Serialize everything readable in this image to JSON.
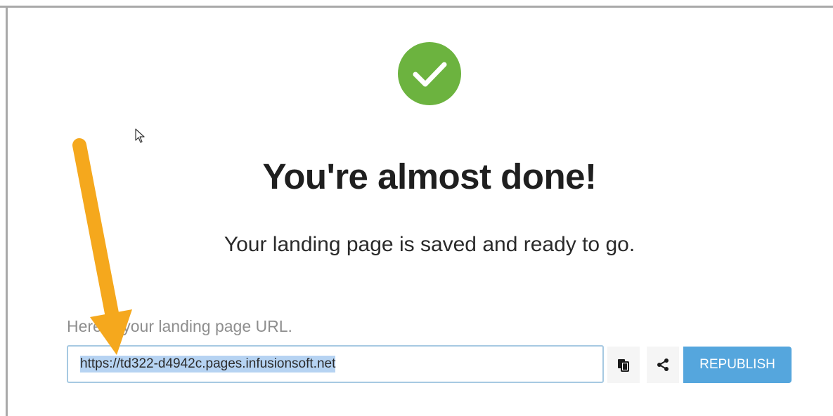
{
  "header": {
    "status_icon": "checkmark-icon",
    "status_color": "#6cb33f",
    "title": "You're almost done!",
    "subtitle": "Your landing page is saved and ready to go."
  },
  "url_section": {
    "label": "Here is your landing page URL.",
    "url_value": "https://td322-d4942c.pages.infusionsoft.net",
    "copy_icon": "copy-icon",
    "share_icon": "share-icon",
    "republish_label": "REPUBLISH",
    "accent_color": "#55a6dd"
  },
  "annotation": {
    "arrow_icon": "orange-arrow-icon",
    "arrow_color": "#f5a81d"
  }
}
